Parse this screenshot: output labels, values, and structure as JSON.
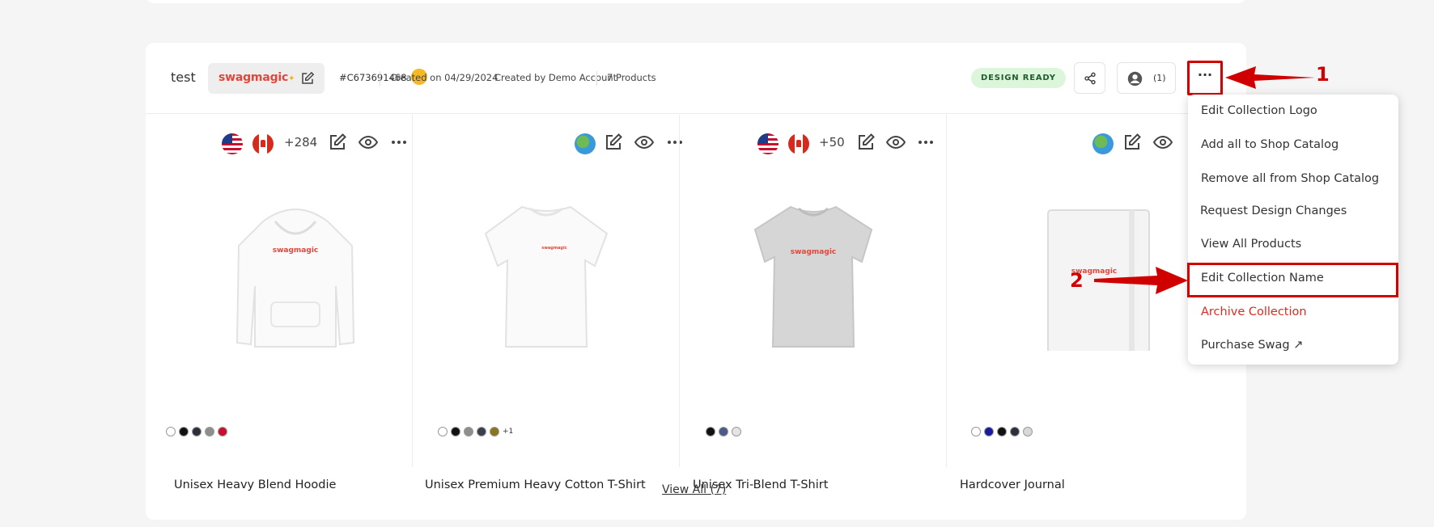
{
  "collection": {
    "name": "test",
    "brand": "swagmagic",
    "id": "#C673691468",
    "created_on": "Created on 04/29/2024",
    "created_by": "Created by Demo Account",
    "product_count": "7 Products",
    "status": "DESIGN READY",
    "users_count": "(1)",
    "more_label": "···"
  },
  "products": [
    {
      "name": "Unisex Heavy Blend Hoodie",
      "regions": [
        "us-flag-icon",
        "canada-flag-icon"
      ],
      "region_extra": "+284",
      "swatches": [
        "#ffffff",
        "#111111",
        "#2b2f3a",
        "#8e8e8e",
        "#c8102e"
      ],
      "swatch_more": ""
    },
    {
      "name": "Unisex Premium Heavy Cotton T-Shirt",
      "regions": [
        "globe-icon"
      ],
      "region_extra": "",
      "swatches": [
        "#ffffff",
        "#111111",
        "#8e8e8e",
        "#3a3f4f",
        "#8b7320"
      ],
      "swatch_more": "+1"
    },
    {
      "name": "Unisex Tri-Blend T-Shirt",
      "regions": [
        "us-flag-icon",
        "canada-flag-icon"
      ],
      "region_extra": "+50",
      "swatches": [
        "#111111",
        "#4a5a8a",
        "#e4e4e4"
      ],
      "swatch_more": ""
    },
    {
      "name": "Hardcover Journal",
      "regions": [
        "globe-icon"
      ],
      "region_extra": "",
      "swatches": [
        "#ffffff",
        "#1a1aa0",
        "#111111",
        "#2b2f3a",
        "#d8d8d8"
      ],
      "swatch_more": ""
    }
  ],
  "view_all": "View All (7)",
  "menu": {
    "items": [
      "Edit Collection Logo",
      "Add all to Shop Catalog",
      "Remove all from Shop Catalog",
      "Request Design Changes",
      "View All Products",
      "Edit Collection Name",
      "Archive Collection",
      "Purchase Swag"
    ],
    "purchase_arrow": "↗"
  },
  "annotations": {
    "step1": "1",
    "step2": "2"
  },
  "colors": {
    "brand": "#e2463b",
    "annotation": "#d10000",
    "danger": "#d92d20",
    "status_bg": "#dcf6dc"
  }
}
